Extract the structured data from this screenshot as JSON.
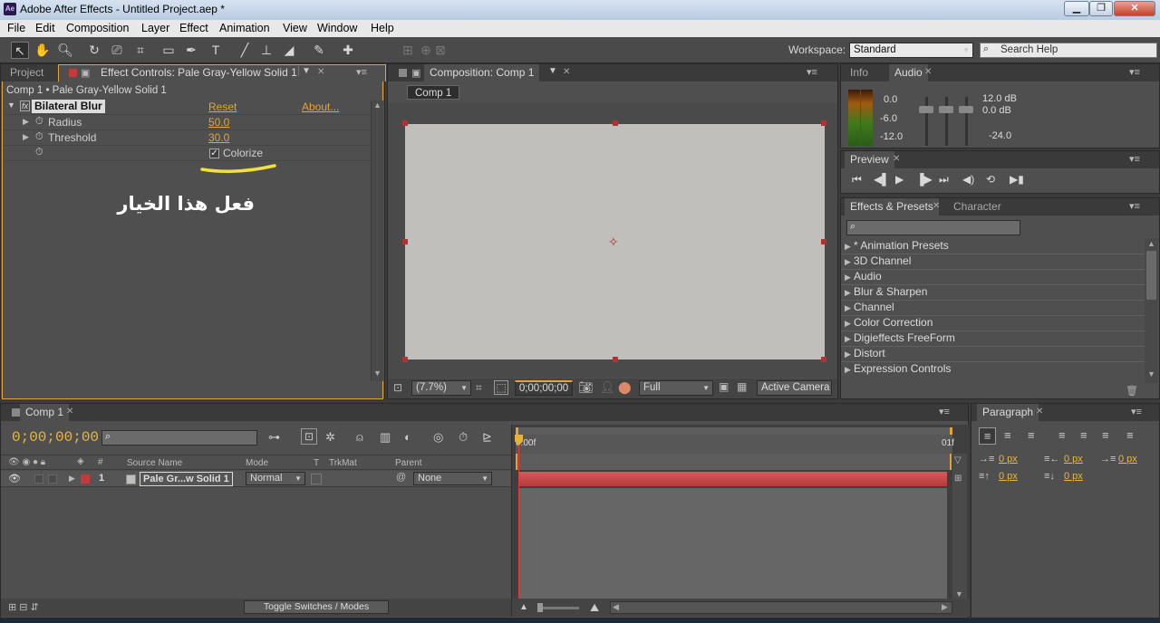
{
  "window": {
    "title": "Adobe After Effects - Untitled Project.aep *",
    "app_icon": "Ae",
    "min": "▁",
    "max": "❐",
    "close": "✕"
  },
  "menu": [
    "File",
    "Edit",
    "Composition",
    "Layer",
    "Effect",
    "Animation",
    "View",
    "Window",
    "Help"
  ],
  "toolbar": {
    "workspace_label": "Workspace:",
    "workspace_value": "Standard",
    "search_placeholder": "Search Help"
  },
  "project_panel": {
    "tab_project": "Project",
    "tab_effect_controls": "Effect Controls: Pale Gray-Yellow Solid 1",
    "breadcrumb": "Comp 1 • Pale Gray-Yellow Solid 1",
    "fx_badge": "fx",
    "effect_name": "Bilateral Blur",
    "reset": "Reset",
    "about": "About...",
    "params": [
      {
        "name": "Radius",
        "value": "50.0"
      },
      {
        "name": "Threshold",
        "value": "30.0"
      }
    ],
    "colorize_label": "Colorize",
    "annotation": "فعل هذا الخيار"
  },
  "composition": {
    "tab": "Composition: Comp 1",
    "comp_button": "Comp 1",
    "zoom": "(7.7%)",
    "timecode": "0;00;00;00",
    "resolution": "Full",
    "camera": "Active Camera"
  },
  "info_panel": {
    "tab_info": "Info",
    "tab_audio": "Audio",
    "levels_left": [
      "0.0",
      "-6.0",
      "-12.0"
    ],
    "levels_right": [
      "12.0 dB",
      "0.0 dB",
      "-24.0"
    ]
  },
  "preview": {
    "tab": "Preview"
  },
  "effects_presets": {
    "tab": "Effects & Presets",
    "tab_character": "Character",
    "items": [
      "* Animation Presets",
      "3D Channel",
      "Audio",
      "Blur & Sharpen",
      "Channel",
      "Color Correction",
      "Digieffects FreeForm",
      "Distort",
      "Expression Controls"
    ]
  },
  "timeline": {
    "tab": "Comp 1",
    "timecode": "0;00;00;00",
    "columns": {
      "hash": "#",
      "source_name": "Source Name",
      "mode": "Mode",
      "t": "T",
      "trkmat": "TrkMat",
      "parent": "Parent"
    },
    "layer": {
      "index": "1",
      "name": "Pale Gr...w Solid 1",
      "mode": "Normal",
      "parent": "None",
      "color": "#c23a3a"
    },
    "ruler_start": "0:00f",
    "ruler_end": "01f",
    "toggle": "Toggle Switches / Modes"
  },
  "paragraph": {
    "tab": "Paragraph",
    "fields": [
      "0 px",
      "0 px",
      "0 px",
      "0 px",
      "0 px"
    ]
  }
}
